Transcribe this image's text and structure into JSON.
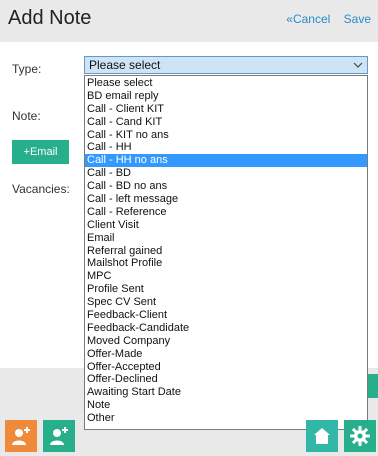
{
  "header": {
    "title": "Add Note",
    "cancel": "«Cancel",
    "save": "Save"
  },
  "form": {
    "type_label": "Type:",
    "note_label": "Note:",
    "email_button": "+Email",
    "vacancies_label": "Vacancies:",
    "selected_value": "Please select"
  },
  "dropdown": {
    "highlighted_index": 6,
    "options": [
      "Please select",
      "BD email reply",
      "Call - Client KIT",
      "Call - Cand KIT",
      "Call - KIT no ans",
      "Call - HH",
      "Call - HH no ans",
      "Call - BD",
      "Call - BD no ans",
      "Call - left message",
      "Call - Reference",
      "Client Visit",
      "Email",
      "Referral gained",
      "Mailshot Profile",
      "MPC",
      "Profile Sent",
      "Spec CV Sent",
      "Feedback-Client",
      "Feedback-Candidate",
      "Moved Company",
      "Offer-Made",
      "Offer-Accepted",
      "Offer-Declined",
      "Awaiting Start Date",
      "Note",
      "Other"
    ]
  },
  "footer": {
    "icons": [
      "add-user-icon",
      "add-user-icon",
      "home-icon",
      "gear-icon"
    ]
  },
  "colors": {
    "accent": "#27ae8a",
    "link": "#2a8bc6",
    "highlight": "#3399ff",
    "orange": "#ee8a3a"
  }
}
